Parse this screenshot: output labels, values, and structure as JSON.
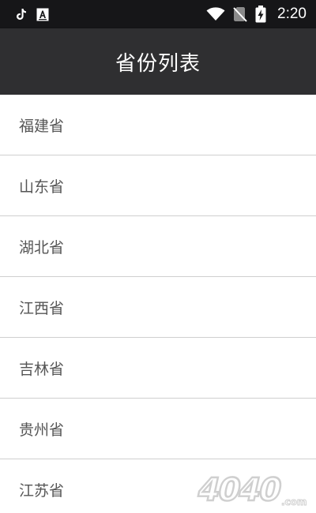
{
  "status_bar": {
    "time": "2:20",
    "left_icons": [
      "tiktok-icon",
      "font-a-icon"
    ],
    "right_icons": [
      "wifi-icon",
      "no-sim-icon",
      "battery-charging-icon"
    ]
  },
  "app_bar": {
    "title": "省份列表",
    "background": "#2f2f31"
  },
  "provinces": [
    {
      "label": "福建省"
    },
    {
      "label": "山东省"
    },
    {
      "label": "湖北省"
    },
    {
      "label": "江西省"
    },
    {
      "label": "吉林省"
    },
    {
      "label": "贵州省"
    },
    {
      "label": "江苏省"
    }
  ],
  "watermark": {
    "text": "4040.com"
  }
}
